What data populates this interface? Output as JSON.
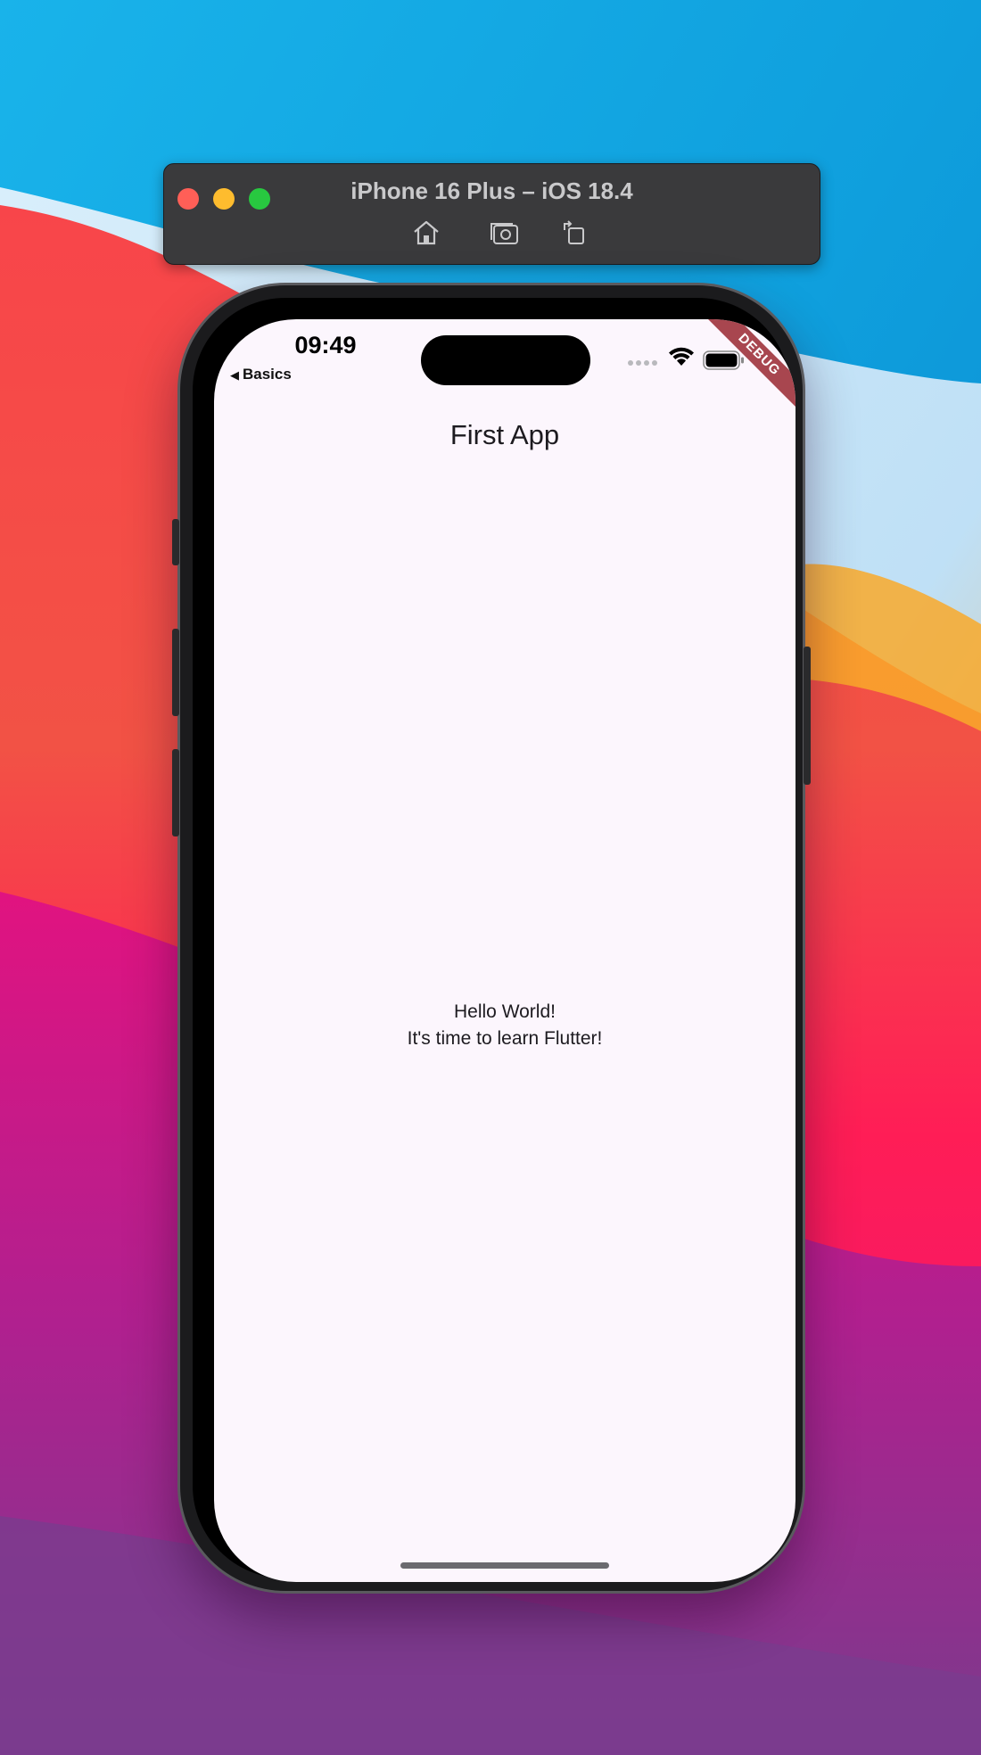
{
  "simulator": {
    "title": "iPhone 16 Plus – iOS 18.4",
    "toolbar": [
      {
        "name": "home",
        "icon": "home-icon"
      },
      {
        "name": "screenshot",
        "icon": "camera-icon"
      },
      {
        "name": "rotate",
        "icon": "rotate-icon"
      }
    ],
    "traffic_lights": {
      "close": "#ff5f57",
      "minimize": "#febc2e",
      "maximize": "#28c840"
    }
  },
  "status_bar": {
    "time": "09:49",
    "back_label": "Basics",
    "back_icon": "back-triangle-icon",
    "icons": [
      "signal-dots-icon",
      "wifi-icon",
      "battery-icon"
    ]
  },
  "debug_banner": "DEBUG",
  "app": {
    "title": "First App",
    "line1": "Hello World!",
    "line2": "It's time to learn Flutter!"
  },
  "colors": {
    "screen_bg": "#fcf6fd",
    "debug_banner": "#a8464f",
    "text": "#1d1b20"
  }
}
